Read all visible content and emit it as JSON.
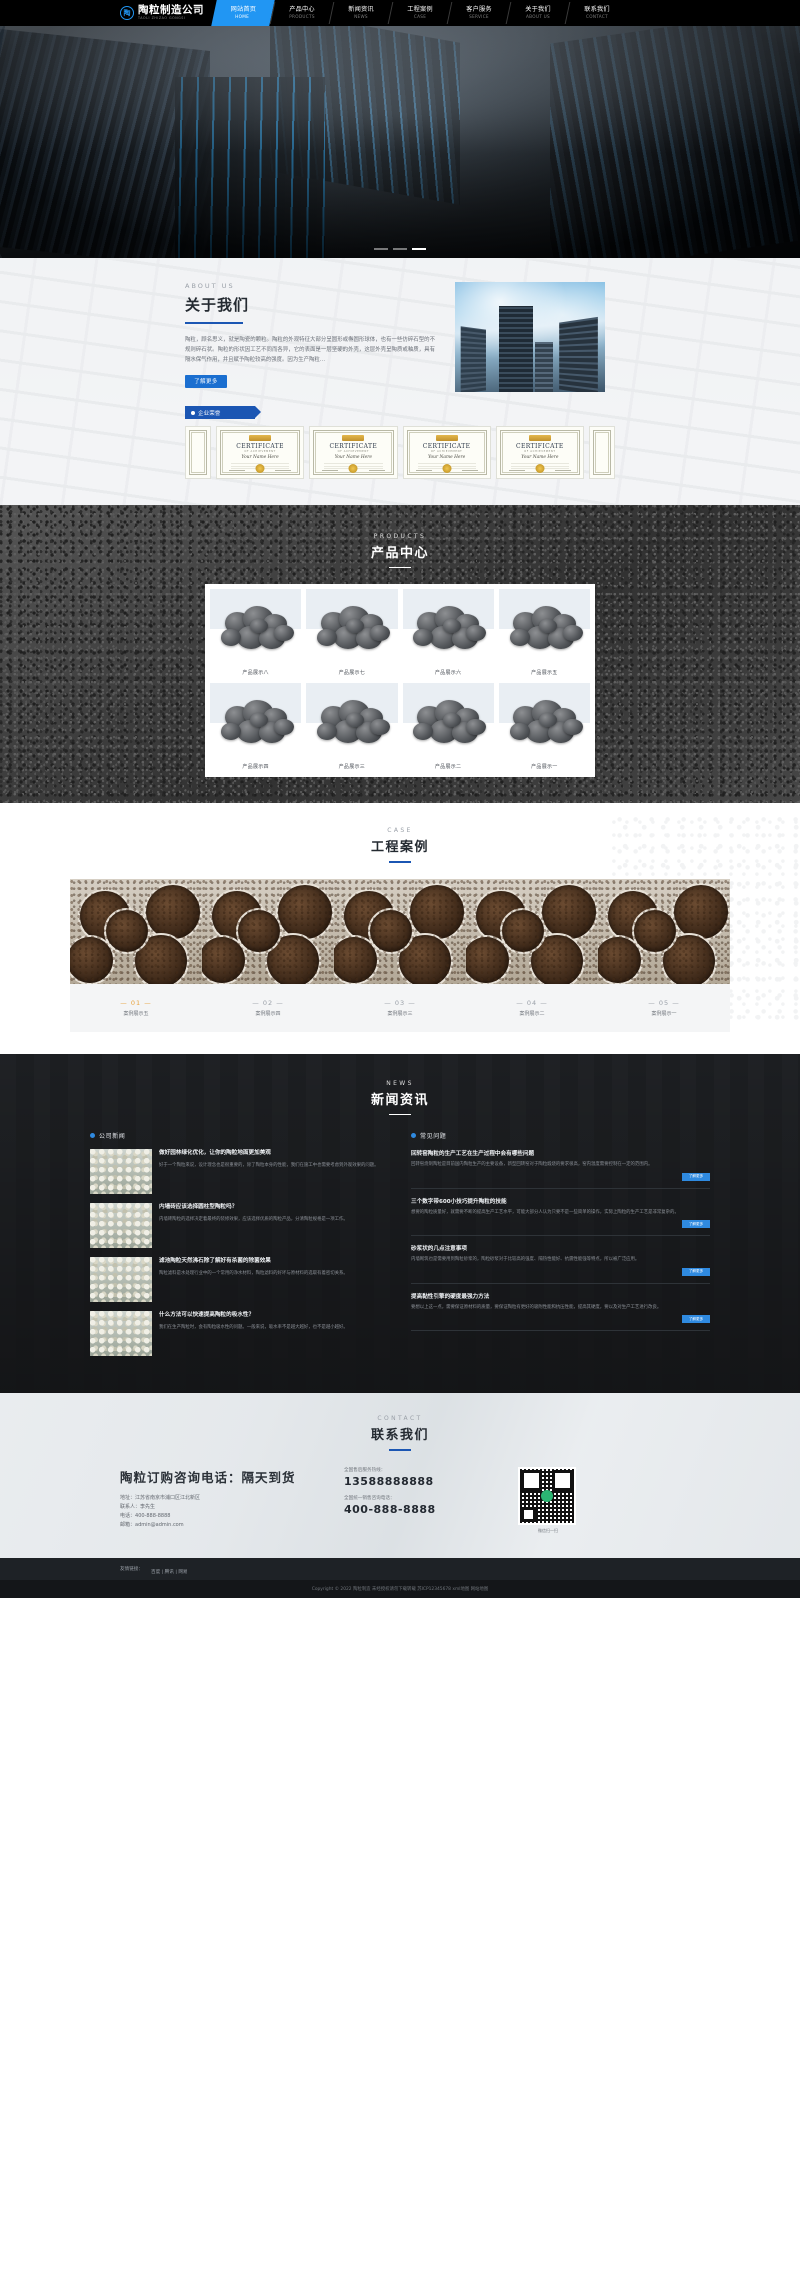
{
  "header": {
    "logo_cn": "陶粒制造公司",
    "logo_en": "TAOLI ZHIZAO GONGSI",
    "logo_glyph": "陶",
    "nav": [
      {
        "cn": "网站首页",
        "en": "HOME",
        "active": true
      },
      {
        "cn": "产品中心",
        "en": "PRODUCTS",
        "active": false
      },
      {
        "cn": "新闻资讯",
        "en": "NEWS",
        "active": false
      },
      {
        "cn": "工程案例",
        "en": "CASE",
        "active": false
      },
      {
        "cn": "客户服务",
        "en": "SERVICE",
        "active": false
      },
      {
        "cn": "关于我们",
        "en": "ABOUT US",
        "active": false
      },
      {
        "cn": "联系我们",
        "en": "CONTACT",
        "active": false
      }
    ]
  },
  "hero": {
    "slide_count": 3,
    "active_slide": 3
  },
  "about": {
    "eyebrow": "ABOUT US",
    "title": "关于我们",
    "paragraph": "陶粒，顾名思义，就是陶瓷的颗粒。陶粒的外观特征大部分呈圆形或椭圆形球体，也有一些仿碎石型的不规则碎石状。陶粒的形状因工艺不同而各异，它的表面是一层坚硬的外壳，这层外壳呈陶质或釉质，具有隔水保气作用，并且赋予陶粒较高的强度。因为生产陶粒…",
    "button": "了解更多",
    "honor_tag": "企业荣誉",
    "certificates": [
      {
        "title": "CERTIFICATE",
        "sub": "OF ACHIEVEMENT",
        "name": "Your Name Here"
      },
      {
        "title": "CERTIFICATE",
        "sub": "OF ACHIEVEMENT",
        "name": "Your Name Here"
      },
      {
        "title": "CERTIFICATE",
        "sub": "OF ACHIEVEMENT",
        "name": "Your Name Here"
      },
      {
        "title": "CERTIFICATE",
        "sub": "OF ACHIEVEMENT",
        "name": "Your Name Here"
      }
    ]
  },
  "products": {
    "eyebrow": "PRODUCTS",
    "title": "产品中心",
    "items": [
      {
        "name": "产品展示八"
      },
      {
        "name": "产品展示七"
      },
      {
        "name": "产品展示六"
      },
      {
        "name": "产品展示五"
      },
      {
        "name": "产品展示四"
      },
      {
        "name": "产品展示三"
      },
      {
        "name": "产品展示二"
      },
      {
        "name": "产品展示一"
      }
    ]
  },
  "case": {
    "eyebrow": "CASE",
    "title": "工程案例",
    "items": [
      {
        "num": "01",
        "name": "案例展示五"
      },
      {
        "num": "02",
        "name": "案例展示四"
      },
      {
        "num": "03",
        "name": "案例展示三"
      },
      {
        "num": "04",
        "name": "案例展示二"
      },
      {
        "num": "05",
        "name": "案例展示一"
      }
    ]
  },
  "news": {
    "eyebrow": "NEWS",
    "title": "新闻资讯",
    "left_tab": "公司新闻",
    "right_tab": "常见问题",
    "more_label": "了解更多",
    "left_items": [
      {
        "title": "做好园林绿化优化，让你的陶粒地面更加美观",
        "text": "好于一个陶粒来说，设计理念也是很重要的，除了陶粒本身的性能，我们在施工中也需要考虑到外观效果的问题。"
      },
      {
        "title": "内墙砖应该选择圆柱型陶粒吗？",
        "text": "内墙砖陶粒的选择决定着最终的装修效果，应该选择优质的陶粒产品，分清陶粒规格是一项工作。"
      },
      {
        "title": "滤池陶粒天然沸石除了解好有杀菌的除菌效果",
        "text": "陶粒滤料是水处理行业中的一个常用的净水材料，陶粒滤料的好坏与原材料的选取有着密切关系。"
      },
      {
        "title": "什么方法可以快速提高陶粒的吸水性？",
        "text": "我们在生产陶粒时，会有陶粒吸水性的问题。一般来说，吸水率不是越大越好，也不是越小越好。"
      }
    ],
    "right_items": [
      {
        "title": "回转窑陶粒的生产工艺在生产过程中会有哪些问题",
        "text": "回转窑烧制陶粒是目前国内陶粒生产的主要设备，新型回转窑对于陶粒煅烧的要求很高，窑内温度需要控制在一定的范围内。"
      },
      {
        "title": "三个数字带600小技巧提升陶粒的技能",
        "text": "想要的陶粒质量好，就需要不断的提高生产工艺水平，可能大部分人认为只要不是一些简单的操作，实际上陶粒的生产工艺是非常复杂的。"
      },
      {
        "title": "砂浆状的几点注意事项",
        "text": "内墙砌筑也是需要用到陶粒砂浆的，陶粒砂浆对于比较高的强度、隔热性能好、抗震性能强等特点，所以被广泛应用。"
      },
      {
        "title": "提高黏性引擎的硬度最强力方法",
        "text": "要想以上这一点，需要保证原材料的质量，要保证陶粒有更好的吸附性能和抗压性能，提高其硬度，要以及对生产工艺进行改良。"
      }
    ]
  },
  "contact": {
    "eyebrow": "CONTACT",
    "title": "联系我们",
    "headline": "陶粒订购咨询电话：隔天到货",
    "address_label": "地址：",
    "address": "江苏省南京市浦口区江北新区",
    "contact_label": "联系人：",
    "contact_person": "李先生",
    "phone_label": "电话：",
    "phone": "400-888-8888",
    "email_label": "邮箱：",
    "email": "admin@admin.com",
    "nat_label": "全国售后服务热线：",
    "nat_number": "13588888888",
    "sales_label": "全国统一销售咨询电话：",
    "sales_number": "400-888-8888",
    "qr_caption": "微信扫一扫"
  },
  "footer": {
    "nav_label": "友情链接：",
    "links": [
      "百度",
      "腾讯",
      "网易"
    ],
    "copyright": "Copyright © 2022 陶粒制造 未经授权请勿下载转载 苏ICP12345678 xml地图 网站地图"
  }
}
